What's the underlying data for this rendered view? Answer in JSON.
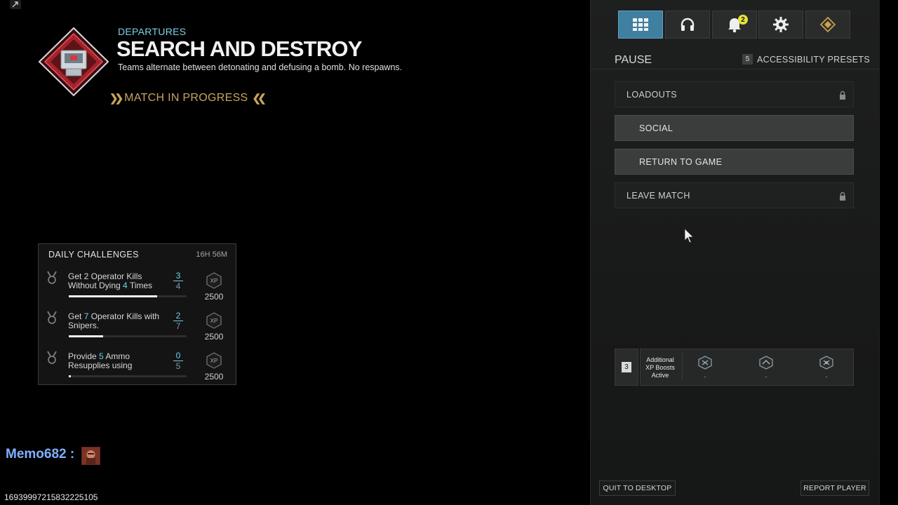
{
  "mode": {
    "category": "DEPARTURES",
    "title": "SEARCH AND DESTROY",
    "description": "Teams alternate between detonating and defusing a bomb. No respawns.",
    "status": "MATCH IN PROGRESS"
  },
  "challenges": {
    "title": "DAILY CHALLENGES",
    "timer": "16H 56M",
    "items": [
      {
        "text_a": "Get 2 Operator Kills",
        "text_b_pre": "Without Dying ",
        "text_b_hl": "4",
        "text_b_post": " Times",
        "current": "3",
        "total": "4",
        "progress": 0.75,
        "reward": "2500"
      },
      {
        "text_a_pre": "Get ",
        "text_a_hl": "7",
        "text_a_post": " Operator Kills with",
        "text_b": "Snipers.",
        "current": "2",
        "total": "7",
        "progress": 0.29,
        "reward": "2500"
      },
      {
        "text_a_pre": "Provide ",
        "text_a_hl": "5",
        "text_a_post": " Ammo",
        "text_b": "Resupplies using",
        "current": "0",
        "total": "5",
        "progress": 0.02,
        "reward": "2500"
      }
    ],
    "xp_icon_label": "XP"
  },
  "chat": {
    "name": "Memo682",
    "separator": ":"
  },
  "build_id": "16939997215832225105",
  "pause_menu": {
    "title": "PAUSE",
    "accessibility_key": "5",
    "accessibility_label": "ACCESSIBILITY PRESETS",
    "notification_count": "2",
    "items": [
      {
        "label": "LOADOUTS",
        "locked": true
      },
      {
        "label": "SOCIAL",
        "locked": false
      },
      {
        "label": "RETURN TO GAME",
        "locked": false
      },
      {
        "label": "LEAVE MATCH",
        "locked": true
      }
    ]
  },
  "xp_boosts": {
    "key": "3",
    "label": "Additional XP Boosts Active",
    "slots": [
      {
        "icon": "xp-boost-icon",
        "value": "-"
      },
      {
        "icon": "weapon-xp-boost-icon",
        "value": "-"
      },
      {
        "icon": "battlepass-xp-boost-icon",
        "value": "-"
      }
    ]
  },
  "footer": {
    "quit": "QUIT TO DESKTOP",
    "report": "REPORT PLAYER"
  },
  "colors": {
    "accent_blue": "#3f7fa0",
    "highlight_cyan": "#6fd0e8",
    "status_gold": "#c7a461",
    "badge_yellow": "#e8e23a"
  }
}
